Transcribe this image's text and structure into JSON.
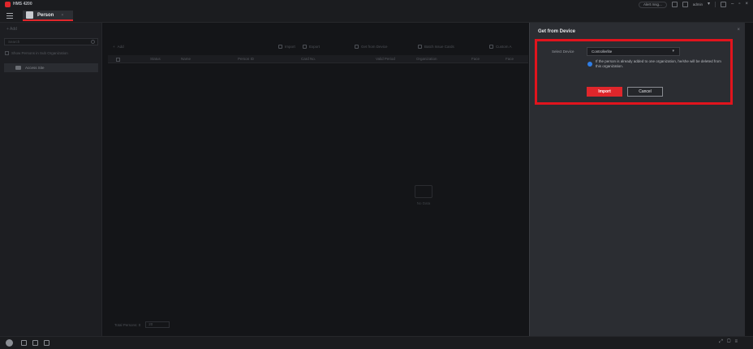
{
  "app": {
    "name": "HMS 4200"
  },
  "titlebar": {
    "pill": "Alert msg...",
    "user": "admin",
    "icons": [
      "message-icon",
      "grid-icon",
      "user-icon",
      "lock-icon",
      "minimize-icon",
      "maximize-icon",
      "close-icon"
    ]
  },
  "tabs": [
    {
      "label": "Person",
      "icon": "person-icon"
    }
  ],
  "left_panel": {
    "add_label": "+ Add",
    "search_placeholder": "Search",
    "checkbox_label": "Show Persons in Sub Organization",
    "org_item": "Access Site"
  },
  "toolbar": {
    "add": "Add",
    "import": "Import",
    "export": "Export",
    "get_from_device": "Get from Device",
    "batch_issue": "Batch Issue Cards",
    "custom": "Custom A"
  },
  "table": {
    "columns": [
      "Status",
      "Name",
      "Person ID",
      "Card No.",
      "Valid Period",
      "Organization",
      "Face",
      "Face"
    ]
  },
  "empty_state": {
    "text": "No Data"
  },
  "pager": {
    "label": "Total Persons: 0",
    "page_size": "20"
  },
  "dialog": {
    "title": "Get from Device",
    "select_device_label": "Select Device",
    "select_device_value": "Controllerlite",
    "note": "If the person is already added to one organization, he/she will be deleted from this organization.",
    "import_label": "Import",
    "cancel_label": "Cancel"
  },
  "status_icons": [
    "logo-icon",
    "alarm-icon",
    "grid-icon",
    "arrow-icon"
  ],
  "colors": {
    "accent": "#e0262b",
    "highlight": "#e1141d",
    "checkbox": "#2f7ee6"
  }
}
